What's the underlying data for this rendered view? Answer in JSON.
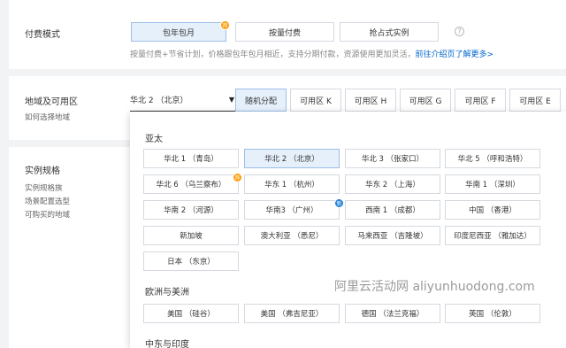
{
  "billing": {
    "label": "付费模式",
    "options": [
      {
        "label": "包年包月",
        "badge": "荐"
      },
      {
        "label": "按量付费"
      },
      {
        "label": "抢占式实例"
      }
    ],
    "help": "?",
    "desc_text": "按量付费+节省计划，价格跟包年包月相近，支持分期付款，资源使用更加灵活，",
    "desc_link": "前往介绍页了解更多>"
  },
  "region": {
    "label": "地域及可用区",
    "sub_label": "如何选择地域",
    "selected": "华北 2 （北京）",
    "caret": "▼",
    "zones": [
      "随机分配",
      "可用区 K",
      "可用区 H",
      "可用区 G",
      "可用区 F",
      "可用区 E"
    ]
  },
  "spec": {
    "label": "实例规格",
    "sub_items": [
      "实例规格族",
      "场景配置选型",
      "可购买的地域"
    ]
  },
  "dropdown": {
    "groups": [
      {
        "title": "亚太",
        "items": [
          {
            "label": "华北 1 （青岛）"
          },
          {
            "label": "华北 2 （北京）"
          },
          {
            "label": "华北 3 （张家口）"
          },
          {
            "label": "华北 5 （呼和浩特）"
          },
          {
            "label": "华北 6 （乌兰察布）",
            "badge": "荐"
          },
          {
            "label": "华东 1 （杭州）"
          },
          {
            "label": "华东 2 （上海）"
          },
          {
            "label": "华南 1 （深圳）"
          },
          {
            "label": "华南 2 （河源）"
          },
          {
            "label": "华南3 （广州）",
            "badge": "新"
          },
          {
            "label": "西南 1 （成都）"
          },
          {
            "label": "中国 （香港）"
          },
          {
            "label": "新加坡"
          },
          {
            "label": "澳大利亚 （悉尼）"
          },
          {
            "label": "马来西亚 （吉隆坡）"
          },
          {
            "label": "印度尼西亚 （雅加达）"
          },
          {
            "label": "日本 （东京）"
          }
        ]
      },
      {
        "title": "欧洲与美洲",
        "items": [
          {
            "label": "美国 （硅谷）"
          },
          {
            "label": "美国 （弗吉尼亚）"
          },
          {
            "label": "德国 （法兰克福）"
          },
          {
            "label": "英国 （伦敦）"
          }
        ]
      },
      {
        "title": "中东与印度",
        "items": []
      }
    ]
  },
  "watermark": "阿里云活动网 aliyunhuodong.com",
  "colors": {
    "accent": "#06c",
    "selected_bg": "#e6f0fb",
    "badge_orange": "#ff9900",
    "badge_blue": "#1b7bd6"
  }
}
